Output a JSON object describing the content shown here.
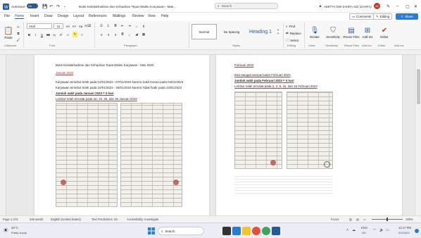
{
  "titlebar": {
    "autosave": "AutoSave",
    "autosave_state": "On",
    "doc_title": "Bukti Ketidakhadiran dan Kehadiran Tepat Waktu Karyawan - Mas...",
    "search_placeholder": "Search",
    "user_name": "ADETYA DWI ZAHRA AZZ (ZAHRA)",
    "user_initials": "AZ"
  },
  "menu": [
    "File",
    "Home",
    "Insert",
    "Draw",
    "Design",
    "Layout",
    "References",
    "Mailings",
    "Review",
    "View",
    "Help"
  ],
  "menu_right": {
    "comments": "Comments",
    "editing": "Editing",
    "share": "Share"
  },
  "ribbon": {
    "paste": "Paste",
    "font_name": "Arial",
    "font_size": "11",
    "styles": [
      "Normal",
      "No Spacing",
      "Heading 1"
    ],
    "find": "Find",
    "replace": "Replace",
    "select": "Select",
    "tools": [
      "Dictate",
      "Sensitivity",
      "Add-ins",
      "Editor"
    ],
    "tool_sub": [
      "Voice",
      "Sensitivity",
      "Add-ins",
      "Editor"
    ],
    "groups": [
      "Clipboard",
      "Font",
      "Paragraph",
      "Styles",
      "Editing",
      "Voice",
      "Sensitivity",
      "Add-ins"
    ],
    "extra": "Reuse Files",
    "extra_sub": "Reuse Files"
  },
  "page1": {
    "heading": "Bukti Ketidakhadiran dan Kehadiran Tepat Waktu Karyawan - Mas 2023",
    "date": "Januari 2023",
    "line1": "Karyawan tersebut telah pada 01/01/2023 - 07/01/2023 karena Sakit Kanan pada 04/01/2023",
    "line2": "Karyawan tersebut telah pada 22/01/2023 - 28/01/2023 karena Tidak hadir pada 24/01/2023",
    "line3": "Jumlah sakit pada Januari 2023 = 2 hari",
    "line4": "Lembur telah tercatat pada 18, 19, 20, dan 30 Januari 2023"
  },
  "page2": {
    "heading": "Februari 2023",
    "line1": "Dari tanggal sampai bulan Februari 2023",
    "line2": "Jumlah sakit pada Februari 2023 = 0 hari",
    "line3": "Lembur telah tercatat pada 2, 3, 8, 15, dan 16 Februari 2023"
  },
  "status": {
    "page": "Page 1 of 8",
    "words": "345 words",
    "lang": "English (United States)",
    "text_pred": "Text Predictions: On",
    "access": "Accessibility: Investigate",
    "focus": "Focus",
    "zoom": "100%"
  },
  "taskbar": {
    "weather_temp": "32°C",
    "weather_desc": "Partly sunny",
    "search": "Search",
    "lang": "ENG",
    "lang_sub": "US",
    "time": "12:17 PM",
    "date": "2/2/2023"
  },
  "colors": {
    "accent": "#2b579a",
    "share": "#2b7cd3",
    "user_badge": "#c0392b"
  }
}
